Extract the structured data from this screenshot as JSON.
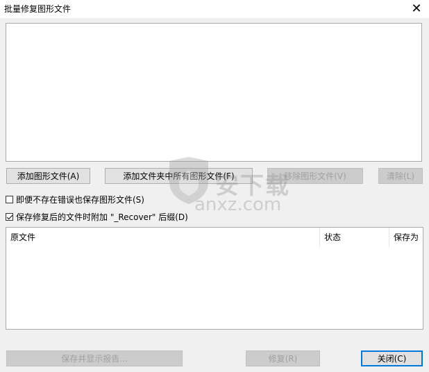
{
  "window": {
    "title": "批量修复图形文件",
    "close_symbol": "✕"
  },
  "buttons": {
    "add_drawing": "添加图形文件(A)",
    "add_folder": "添加文件夹中所有图形文件(F)",
    "remove_drawing": "移除图形文件(V)",
    "clear": "清除(L)",
    "save_report": "保存并显示报告...",
    "recover": "修复(R)",
    "close": "关闭(C)"
  },
  "options": {
    "save_even_if_errors": {
      "label": "即便不存在错误也保存图形文件(S)",
      "checked": false
    },
    "append_recover_suffix": {
      "label": "保存修复后的文件时附加 \"_Recover\" 后缀(D)",
      "checked": true
    }
  },
  "table": {
    "columns": [
      "原文件",
      "状态",
      "保存为"
    ],
    "rows": []
  },
  "watermark": {
    "cn": "安下载",
    "url": "anxz.com"
  }
}
